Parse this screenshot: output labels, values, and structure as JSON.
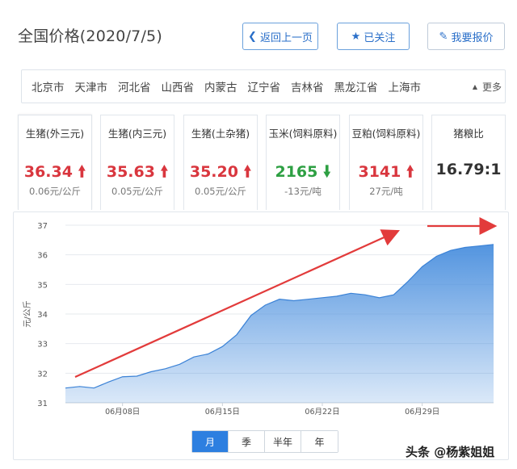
{
  "header": {
    "title": "全国价格(2020/7/5)",
    "back_label": "返回上一页",
    "follow_label": "已关注",
    "report_label": "我要报价"
  },
  "regions": {
    "items": [
      "北京市",
      "天津市",
      "河北省",
      "山西省",
      "内蒙古",
      "辽宁省",
      "吉林省",
      "黑龙江省",
      "上海市"
    ],
    "more_label": "更多"
  },
  "cards": [
    {
      "name": "生猪(外三元)",
      "value": "36.34",
      "change": "0.06元/公斤",
      "direction": "up"
    },
    {
      "name": "生猪(内三元)",
      "value": "35.63",
      "change": "0.05元/公斤",
      "direction": "up"
    },
    {
      "name": "生猪(土杂猪)",
      "value": "35.20",
      "change": "0.05元/公斤",
      "direction": "up"
    },
    {
      "name": "玉米(饲料原料)",
      "value": "2165",
      "change": "-13元/吨",
      "direction": "down"
    },
    {
      "name": "豆粕(饲料原料)",
      "value": "3141",
      "change": "27元/吨",
      "direction": "up"
    },
    {
      "name": "猪粮比",
      "value": "16.79:1",
      "change": "",
      "direction": "none"
    }
  ],
  "chart_data": {
    "type": "area",
    "ylabel": "元/公斤",
    "ylim": [
      31,
      37
    ],
    "yticks": [
      31,
      32,
      33,
      34,
      35,
      36,
      37
    ],
    "x_tick_labels": [
      "06月08日",
      "06月15日",
      "06月22日",
      "06月29日"
    ],
    "x_tick_positions": [
      5,
      12,
      19,
      26
    ],
    "x": [
      1,
      2,
      3,
      4,
      5,
      6,
      7,
      8,
      9,
      10,
      11,
      12,
      13,
      14,
      15,
      16,
      17,
      18,
      19,
      20,
      21,
      22,
      23,
      24,
      25,
      26,
      27,
      28,
      29,
      30,
      31
    ],
    "values": [
      31.5,
      31.55,
      31.5,
      31.7,
      31.88,
      31.9,
      32.05,
      32.15,
      32.3,
      32.55,
      32.65,
      32.9,
      33.3,
      33.95,
      34.3,
      34.5,
      34.45,
      34.5,
      34.55,
      34.6,
      34.7,
      34.65,
      34.55,
      34.65,
      35.1,
      35.6,
      35.95,
      36.15,
      36.25,
      36.3,
      36.35
    ],
    "grid": true,
    "colors": {
      "fill": "#4a8fde",
      "line": "#3b82d6",
      "arrow": "#e23b3b"
    }
  },
  "tabs": [
    {
      "label": "月",
      "active": true
    },
    {
      "label": "季",
      "active": false
    },
    {
      "label": "半年",
      "active": false
    },
    {
      "label": "年",
      "active": false
    }
  ],
  "watermark": "头条 @杨紫姐姐"
}
